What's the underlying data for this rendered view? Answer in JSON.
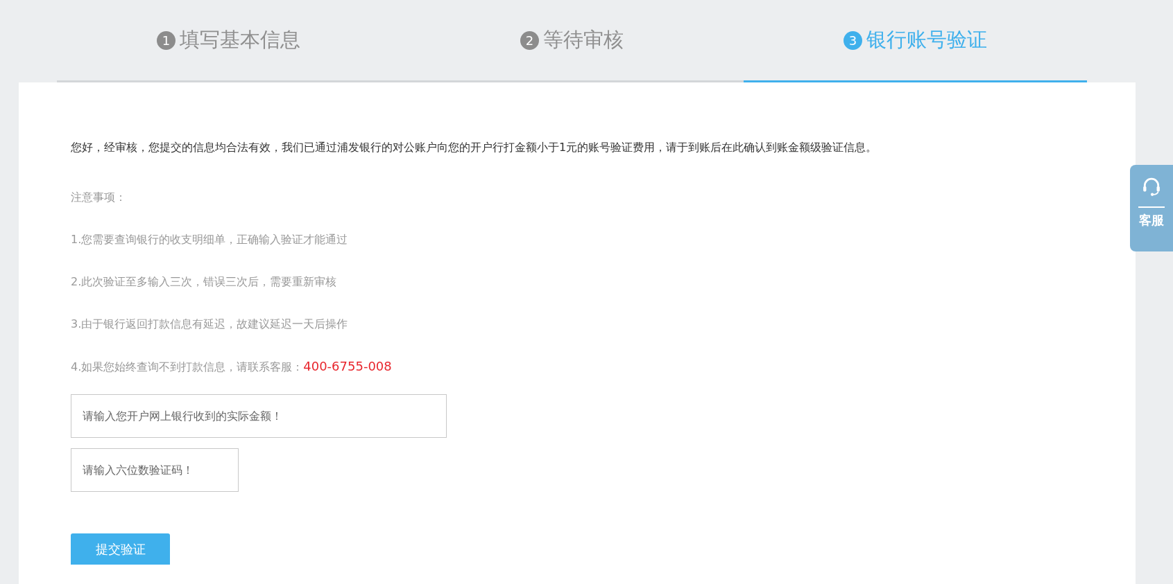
{
  "steps": [
    {
      "number": "1",
      "label": "填写基本信息",
      "selected": false
    },
    {
      "number": "2",
      "label": "等待审核",
      "selected": false
    },
    {
      "number": "3",
      "label": "银行账号验证",
      "selected": true
    }
  ],
  "intro": "您好，经审核，您提交的信息均合法有效，我们已通过浦发银行的对公账户向您的开户行打金额小于1元的账号验证费用，请于到账后在此确认到账金额级验证信息。",
  "notes_title": "注意事项：",
  "notes": [
    {
      "text": "1.您需要查询银行的收支明细单，正确输入验证才能通过"
    },
    {
      "text": "2.此次验证至多输入三次，错误三次后，需要重新审核"
    },
    {
      "text": "3.由于银行返回打款信息有延迟，故建议延迟一天后操作"
    },
    {
      "text": "4.如果您始终查询不到打款信息，请联系客服：",
      "phone": "400-6755-008"
    }
  ],
  "fields": [
    {
      "placeholder": "请输入您开户网上银行收到的实际金额！",
      "kind": "wide"
    },
    {
      "placeholder": "请输入六位数验证码！",
      "kind": "narrow"
    }
  ],
  "submit_button": "提交验证",
  "service_tab": {
    "label": "客服"
  }
}
